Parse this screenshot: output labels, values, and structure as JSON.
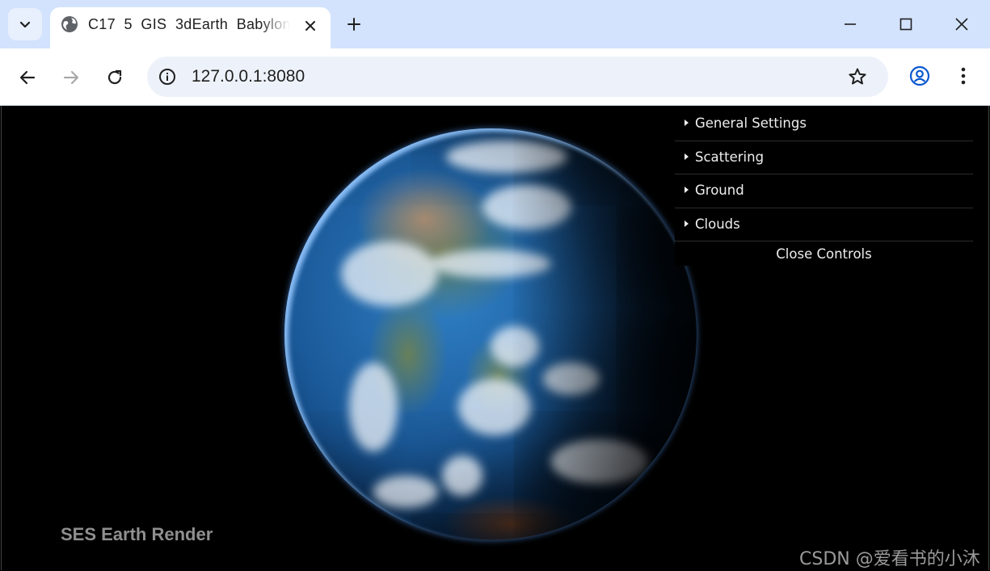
{
  "browser": {
    "tab_title": "C17  5  GIS  3dEarth  BabylonJ",
    "url": "127.0.0.1:8080"
  },
  "icons": {
    "tab_search": "chevron-down-icon",
    "favicon": "globe-icon",
    "tab_close": "close-icon",
    "new_tab": "plus-icon",
    "back": "arrow-left-icon",
    "forward": "arrow-right-icon",
    "reload": "reload-icon",
    "site_info": "info-icon",
    "bookmark": "star-icon",
    "profile": "account-icon",
    "menu": "more-vert-icon"
  },
  "controls": {
    "folders": [
      {
        "label": "General Settings"
      },
      {
        "label": "Scattering"
      },
      {
        "label": "Ground"
      },
      {
        "label": "Clouds"
      }
    ],
    "close_label": "Close Controls"
  },
  "scene": {
    "brand_label": "SES Earth Render"
  },
  "watermark": "CSDN @爱看书的小沐",
  "colors": {
    "tabbar_bg": "#d3e3fd",
    "omnibox_bg": "#edf2fa",
    "accent_profile": "#0b57d0"
  }
}
